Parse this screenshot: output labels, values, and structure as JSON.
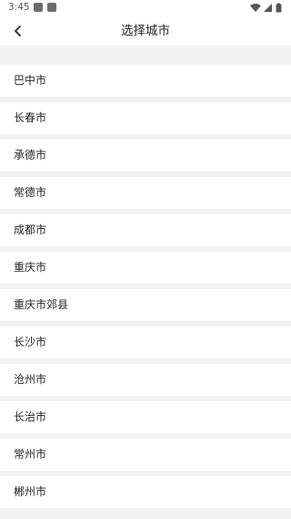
{
  "status_bar": {
    "time": "3:45",
    "icons": [
      "notification-square-icon",
      "notification-square-icon",
      "wifi-icon",
      "signal-icon",
      "battery-icon"
    ]
  },
  "nav": {
    "back_icon": "chevron-left-icon",
    "title": "选择城市"
  },
  "cities": [
    {
      "label": "巴中市"
    },
    {
      "label": "长春市"
    },
    {
      "label": "承德市"
    },
    {
      "label": "常德市"
    },
    {
      "label": "成都市"
    },
    {
      "label": "重庆市"
    },
    {
      "label": "重庆市郊县"
    },
    {
      "label": "长沙市"
    },
    {
      "label": "沧州市"
    },
    {
      "label": "长治市"
    },
    {
      "label": "常州市"
    },
    {
      "label": "郴州市"
    }
  ],
  "colors": {
    "background": "#f2f2f2",
    "item_background": "#ffffff",
    "text": "#222222"
  }
}
